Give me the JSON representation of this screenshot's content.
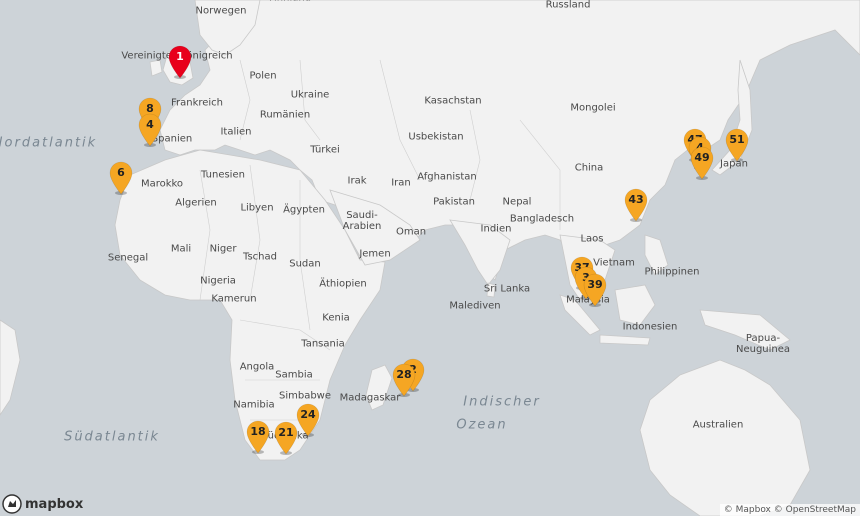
{
  "map": {
    "land_color": "#f2f2f2",
    "water_color": "#cdd3d8",
    "border_color": "#bfbfbf",
    "marker_color": "#f5a623",
    "active_marker_color": "#e8001c"
  },
  "labels": [
    {
      "id": "russland",
      "text": "Russland",
      "type": "country"
    },
    {
      "id": "finnland",
      "text": "Finnland",
      "type": "country"
    },
    {
      "id": "norwegen",
      "text": "Norwegen",
      "type": "country"
    },
    {
      "id": "uk",
      "text": "Vereinigtes Königreich",
      "type": "country"
    },
    {
      "id": "polen",
      "text": "Polen",
      "type": "country"
    },
    {
      "id": "ukraine",
      "text": "Ukraine",
      "type": "country"
    },
    {
      "id": "frankreich",
      "text": "Frankreich",
      "type": "country"
    },
    {
      "id": "rumanien",
      "text": "Rumänien",
      "type": "country"
    },
    {
      "id": "italien",
      "text": "Italien",
      "type": "country"
    },
    {
      "id": "spanien",
      "text": "Spanien",
      "type": "country"
    },
    {
      "id": "turkei",
      "text": "Türkei",
      "type": "country"
    },
    {
      "id": "kasachstan",
      "text": "Kasachstan",
      "type": "country"
    },
    {
      "id": "mongolei",
      "text": "Mongolei",
      "type": "country"
    },
    {
      "id": "usbekistan",
      "text": "Usbekistan",
      "type": "country"
    },
    {
      "id": "china",
      "text": "China",
      "type": "country"
    },
    {
      "id": "japan",
      "text": "Japan",
      "type": "country"
    },
    {
      "id": "marokko",
      "text": "Marokko",
      "type": "country"
    },
    {
      "id": "tunesien",
      "text": "Tunesien",
      "type": "country"
    },
    {
      "id": "irak",
      "text": "Irak",
      "type": "country"
    },
    {
      "id": "iran",
      "text": "Iran",
      "type": "country"
    },
    {
      "id": "afghanistan",
      "text": "Afghanistan",
      "type": "country"
    },
    {
      "id": "algerien",
      "text": "Algerien",
      "type": "country"
    },
    {
      "id": "libyen",
      "text": "Libyen",
      "type": "country"
    },
    {
      "id": "agypten",
      "text": "Ägypten",
      "type": "country"
    },
    {
      "id": "nepal",
      "text": "Nepal",
      "type": "country"
    },
    {
      "id": "pakistan",
      "text": "Pakistan",
      "type": "country"
    },
    {
      "id": "saudi",
      "text": "Saudi-\nArabien",
      "type": "country"
    },
    {
      "id": "bangladesch",
      "text": "Bangladesch",
      "type": "country"
    },
    {
      "id": "oman",
      "text": "Oman",
      "type": "country"
    },
    {
      "id": "indien",
      "text": "Indien",
      "type": "country"
    },
    {
      "id": "laos",
      "text": "Laos",
      "type": "country"
    },
    {
      "id": "mali",
      "text": "Mali",
      "type": "country"
    },
    {
      "id": "niger",
      "text": "Niger",
      "type": "country"
    },
    {
      "id": "tschad",
      "text": "Tschad",
      "type": "country"
    },
    {
      "id": "sudan",
      "text": "Sudan",
      "type": "country"
    },
    {
      "id": "jemen",
      "text": "Jemen",
      "type": "country"
    },
    {
      "id": "vietnam",
      "text": "Vietnam",
      "type": "country"
    },
    {
      "id": "philippinen",
      "text": "Philippinen",
      "type": "country"
    },
    {
      "id": "senegal",
      "text": "Senegal",
      "type": "country"
    },
    {
      "id": "nigeria",
      "text": "Nigeria",
      "type": "country"
    },
    {
      "id": "athiopien",
      "text": "Äthiopien",
      "type": "country"
    },
    {
      "id": "srilanka",
      "text": "Sri Lanka",
      "type": "country"
    },
    {
      "id": "kamerun",
      "text": "Kamerun",
      "type": "country"
    },
    {
      "id": "malaysia",
      "text": "Malaysia",
      "type": "country"
    },
    {
      "id": "kenia",
      "text": "Kenia",
      "type": "country"
    },
    {
      "id": "malediven",
      "text": "Malediven",
      "type": "country"
    },
    {
      "id": "indonesien",
      "text": "Indonesien",
      "type": "country"
    },
    {
      "id": "papua",
      "text": "Papua-\nNeuguinea",
      "type": "country"
    },
    {
      "id": "tansania",
      "text": "Tansania",
      "type": "country"
    },
    {
      "id": "angola",
      "text": "Angola",
      "type": "country"
    },
    {
      "id": "sambia",
      "text": "Sambia",
      "type": "country"
    },
    {
      "id": "simbabwe",
      "text": "Simbabwe",
      "type": "country"
    },
    {
      "id": "madagaskar",
      "text": "Madagaskar",
      "type": "country"
    },
    {
      "id": "namibia",
      "text": "Namibia",
      "type": "country"
    },
    {
      "id": "australien",
      "text": "Australien",
      "type": "country"
    },
    {
      "id": "suedafrika",
      "text": "Südafrika",
      "type": "country"
    },
    {
      "id": "nordatlantik",
      "text": "Nordatlantik",
      "type": "sea"
    },
    {
      "id": "suedatlantik",
      "text": "Südatlantik",
      "type": "sea"
    },
    {
      "id": "indischer",
      "text": "Indischer",
      "type": "sea"
    },
    {
      "id": "ozean",
      "text": "Ozean",
      "type": "sea"
    }
  ],
  "markers": [
    {
      "label": "1",
      "active": true
    },
    {
      "label": "8",
      "active": false
    },
    {
      "label": "4",
      "active": false
    },
    {
      "label": "6",
      "active": false
    },
    {
      "label": "18",
      "active": false
    },
    {
      "label": "21",
      "active": false
    },
    {
      "label": "24",
      "active": false
    },
    {
      "label": "2",
      "active": false
    },
    {
      "label": "28",
      "active": false
    },
    {
      "label": "37",
      "active": false
    },
    {
      "label": "3",
      "active": false
    },
    {
      "label": "39",
      "active": false
    },
    {
      "label": "43",
      "active": false
    },
    {
      "label": "47",
      "active": false
    },
    {
      "label": "4",
      "active": false
    },
    {
      "label": "49",
      "active": false
    },
    {
      "label": "51",
      "active": false
    }
  ],
  "logo": {
    "text": "mapbox"
  },
  "attribution": {
    "mapbox": "© Mapbox",
    "osm": "© OpenStreetMap"
  }
}
